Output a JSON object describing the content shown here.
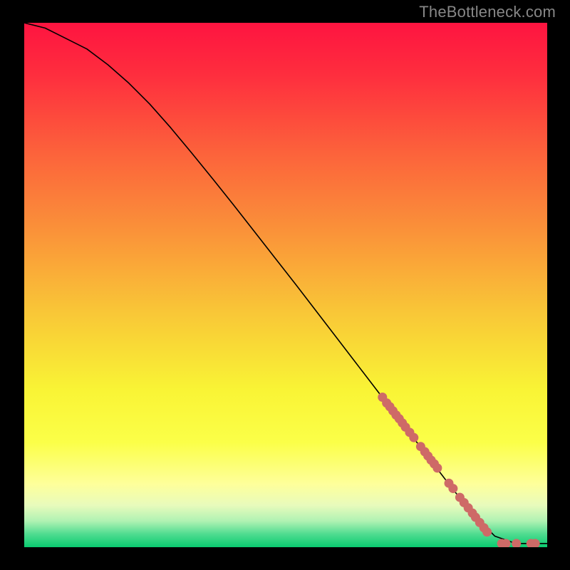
{
  "watermark": "TheBottleneck.com",
  "chart_data": {
    "type": "line",
    "title": "",
    "xlabel": "",
    "ylabel": "",
    "xlim": [
      0,
      100
    ],
    "ylim": [
      0,
      100
    ],
    "grid": false,
    "legend": false,
    "series": [
      {
        "name": "curve",
        "style": "line",
        "color": "#000000",
        "x": [
          0,
          4,
          8,
          12,
          16,
          20,
          24,
          28,
          32,
          36,
          40,
          44,
          48,
          52,
          56,
          60,
          64,
          68,
          72,
          76,
          80,
          82,
          86,
          90,
          94,
          98,
          100
        ],
        "y": [
          100,
          99,
          97,
          95,
          92,
          88.5,
          84.5,
          80,
          75.2,
          70.3,
          65.3,
          60.2,
          55.1,
          50,
          44.8,
          39.6,
          34.4,
          29.2,
          24,
          18.8,
          13.6,
          11,
          6.1,
          2.1,
          0.7,
          0.7,
          0.7
        ]
      },
      {
        "name": "points",
        "style": "scatter",
        "color": "#CE6A67",
        "x": [
          68.5,
          69.3,
          69.9,
          70.5,
          71.1,
          71.7,
          72.3,
          72.9,
          73.7,
          74.5,
          75.8,
          76.6,
          77.2,
          77.8,
          78.4,
          79.0,
          81.2,
          82.0,
          83.3,
          84.1,
          84.9,
          85.7,
          86.3,
          87.1,
          87.9,
          88.5,
          91.3,
          92.1,
          94.1,
          96.9,
          97.7
        ],
        "y": [
          28.6,
          27.5,
          26.8,
          26.0,
          25.2,
          24.5,
          23.7,
          22.9,
          21.9,
          20.9,
          19.2,
          18.2,
          17.4,
          16.6,
          15.9,
          15.1,
          12.2,
          11.2,
          9.5,
          8.5,
          7.5,
          6.5,
          5.7,
          4.7,
          3.7,
          2.9,
          0.7,
          0.7,
          0.7,
          0.7,
          0.7
        ]
      }
    ],
    "background_gradient_stops": [
      {
        "offset": 0.0,
        "color": "#FE1440"
      },
      {
        "offset": 0.1,
        "color": "#FE2E3E"
      },
      {
        "offset": 0.25,
        "color": "#FC633B"
      },
      {
        "offset": 0.4,
        "color": "#FA9339"
      },
      {
        "offset": 0.55,
        "color": "#F9C637"
      },
      {
        "offset": 0.7,
        "color": "#F9F435"
      },
      {
        "offset": 0.8,
        "color": "#FBFF48"
      },
      {
        "offset": 0.88,
        "color": "#FEFF9B"
      },
      {
        "offset": 0.92,
        "color": "#E8FBBC"
      },
      {
        "offset": 0.95,
        "color": "#B0F2B3"
      },
      {
        "offset": 0.975,
        "color": "#4FDC90"
      },
      {
        "offset": 1.0,
        "color": "#0ACB70"
      }
    ]
  }
}
